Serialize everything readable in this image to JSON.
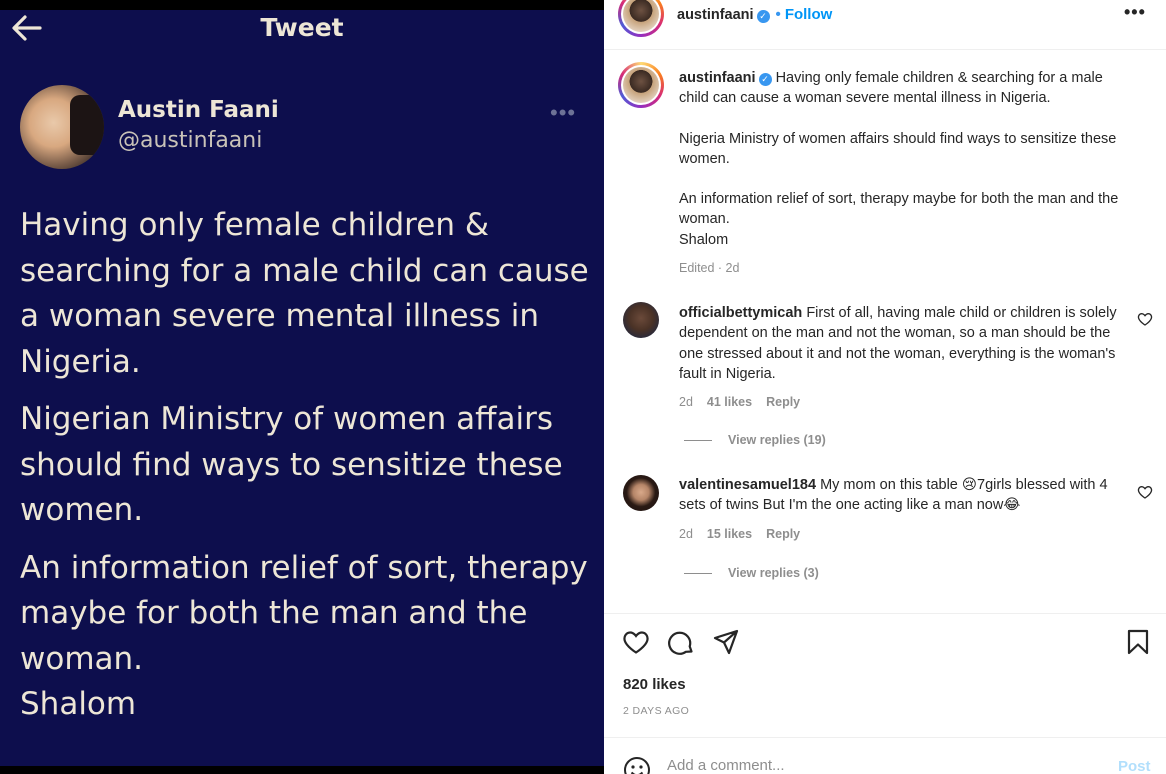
{
  "tweet": {
    "header_title": "Tweet",
    "name": "Austin Faani",
    "handle": "@austinfaani",
    "more": "•••",
    "paragraphs": [
      "Having only female children &\nsearching for a male child can cause\na woman severe mental illness in\nNigeria.",
      "Nigerian Ministry of women affairs\nshould find ways to sensitize these\nwomen.",
      "An information relief of sort, therapy\nmaybe for both the man and the\nwoman.\nShalom"
    ],
    "colors": {
      "background": "#0d0e4d",
      "text": "#ede6d6"
    }
  },
  "instagram": {
    "header": {
      "username": "austinfaani",
      "dot": "•",
      "follow": "Follow",
      "more": "•••"
    },
    "caption": {
      "username": "austinfaani",
      "first_line": "Having only female children & searching for a male child can cause a woman severe mental illness in Nigeria.",
      "second": "Nigeria Ministry of women affairs should find ways to sensitize these women.",
      "third": "An information relief of sort, therapy maybe for both the man and the woman.\nShalom",
      "meta": "Edited · 2d"
    },
    "comments": [
      {
        "username": "officialbettymicah",
        "text": "First of all, having male child or children is solely dependent on the man and not the woman, so a man should be the one stressed about it and not the woman, everything is the woman's fault in Nigeria.",
        "age": "2d",
        "likes": "41 likes",
        "reply": "Reply",
        "view_replies": "View replies (19)"
      },
      {
        "username": "valentinesamuel184",
        "text": "My mom on this table 😢7girls blessed with 4 sets of twins But I'm the one acting like a man now😂",
        "age": "2d",
        "likes": "15 likes",
        "reply": "Reply",
        "view_replies": "View replies (3)"
      }
    ],
    "likes": "820 likes",
    "days_ago": "2 DAYS AGO",
    "comment_box": {
      "placeholder": "Add a comment...",
      "post": "Post"
    },
    "colors": {
      "accent": "#0095f6",
      "verified": "#3897f0",
      "muted": "#8e8e8e"
    },
    "icons": [
      "heart-icon",
      "comment-icon",
      "share-icon",
      "bookmark-icon",
      "emoji-icon"
    ]
  }
}
